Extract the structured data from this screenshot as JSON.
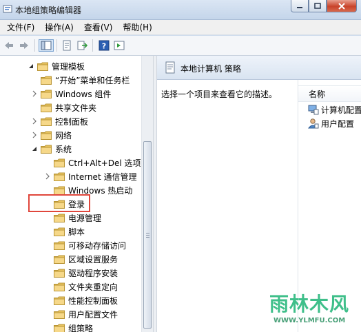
{
  "window": {
    "title": "本地组策略编辑器"
  },
  "menu": [
    "文件(F)",
    "操作(A)",
    "查看(V)",
    "帮助(H)"
  ],
  "toolbar": [
    "back-icon",
    "forward-icon",
    "show-hide-tree-icon",
    "properties-icon",
    "export-list-icon",
    "help-icon",
    "show-action-pane-icon"
  ],
  "tree": {
    "root": {
      "label": "管理模板",
      "expanded": true
    },
    "items": [
      {
        "label": "“开始”菜单和任务栏",
        "expander": "none"
      },
      {
        "label": "Windows 组件",
        "expander": "collapsed"
      },
      {
        "label": "共享文件夹",
        "expander": "none"
      },
      {
        "label": "控制面板",
        "expander": "collapsed"
      },
      {
        "label": "网络",
        "expander": "collapsed"
      },
      {
        "label": "系统",
        "expander": "expanded"
      }
    ],
    "system_children": [
      {
        "label": "Ctrl+Alt+Del 选项",
        "expander": "none"
      },
      {
        "label": "Internet 通信管理",
        "expander": "collapsed"
      },
      {
        "label": "Windows 热启动",
        "expander": "none"
      },
      {
        "label": "登录",
        "expander": "none"
      },
      {
        "label": "电源管理",
        "expander": "none"
      },
      {
        "label": "脚本",
        "expander": "none"
      },
      {
        "label": "可移动存储访问",
        "expander": "none"
      },
      {
        "label": "区域设置服务",
        "expander": "none"
      },
      {
        "label": "驱动程序安装",
        "expander": "none"
      },
      {
        "label": "文件夹重定向",
        "expander": "none"
      },
      {
        "label": "性能控制面板",
        "expander": "none"
      },
      {
        "label": "用户配置文件",
        "expander": "none"
      },
      {
        "label": "组策略",
        "expander": "none"
      }
    ]
  },
  "right": {
    "header": "本地计算机 策略",
    "description": "选择一个项目来查看它的描述。",
    "column": "名称",
    "items": [
      {
        "label": "计算机配置",
        "icon": "computer-config-icon"
      },
      {
        "label": "用户配置",
        "icon": "user-config-icon"
      }
    ]
  },
  "watermark": {
    "main": "雨林木风",
    "sub": "WWW.YLMFU.COM"
  },
  "colors": {
    "highlight": "#e0463b",
    "folder": "#f3d27a"
  }
}
